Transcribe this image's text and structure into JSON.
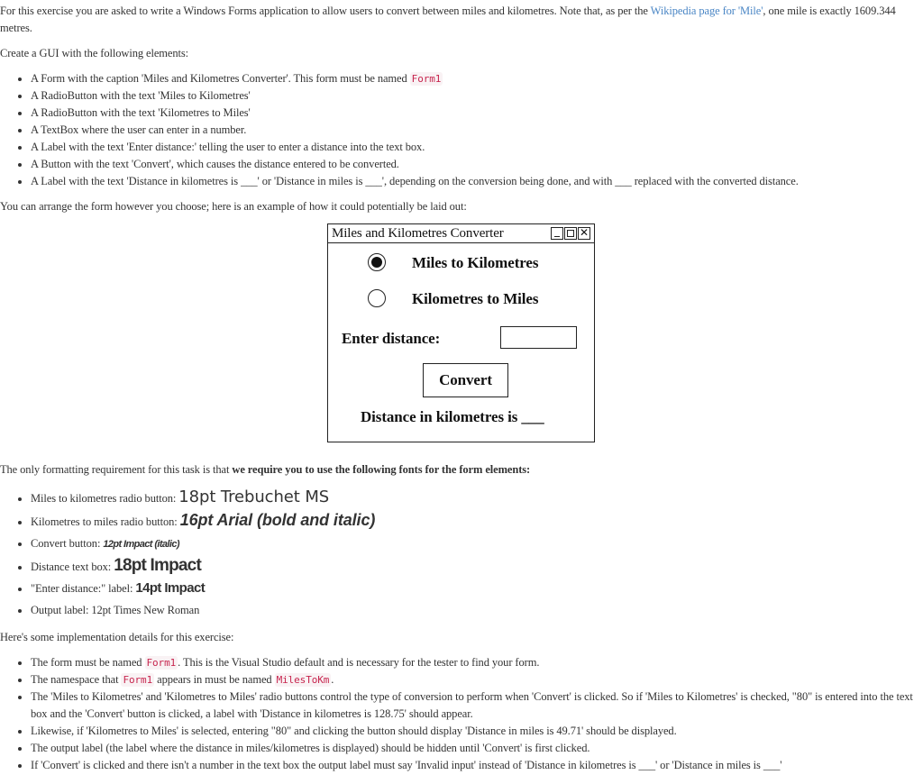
{
  "intro": {
    "text_before_link": "For this exercise you are asked to write a Windows Forms application to allow users to convert between miles and kilometres. Note that, as per the ",
    "link_text": "Wikipedia page for 'Mile'",
    "text_after_link": ", one mile is exactly 1609.344 metres."
  },
  "gui_heading": "Create a GUI with the following elements:",
  "gui_elements": [
    {
      "text": "A Form with the caption 'Miles and Kilometres Converter'. This form must be named ",
      "code": "Form1"
    },
    {
      "text": "A RadioButton with the text 'Miles to Kilometres'"
    },
    {
      "text": "A RadioButton with the text 'Kilometres to Miles'"
    },
    {
      "text": "A TextBox where the user can enter in a number."
    },
    {
      "text": "A Label with the text 'Enter distance:' telling the user to enter a distance into the text box."
    },
    {
      "text": "A Button with the text 'Convert', which causes the distance entered to be converted."
    },
    {
      "text": "A Label with the text 'Distance in kilometres is ___' or 'Distance in miles is ___', depending on the conversion being done, and with ___ replaced with the converted distance."
    }
  ],
  "layout_note": "You can arrange the form however you choose; here is an example of how it could potentially be laid out:",
  "mockup": {
    "title": "Miles and Kilometres Converter",
    "window_buttons": [
      "minimize-icon",
      "maximize-icon",
      "close-icon"
    ],
    "close_glyph": "✕",
    "radio_miles_to_km": "Miles to Kilometres",
    "radio_km_to_miles": "Kilometres to Miles",
    "selected_radio": "Miles to Kilometres",
    "enter_label": "Enter distance:",
    "textbox_value": "",
    "convert_button": "Convert",
    "output_label": "Distance in kilometres is ___"
  },
  "formatting": {
    "text_before_bold": "The only formatting requirement for this task is that ",
    "bold_text": "we require you to use the following fonts for the form elements:"
  },
  "font_requirements": [
    {
      "label": "Miles to kilometres radio button: ",
      "sample": "18pt Trebuchet MS"
    },
    {
      "label": "Kilometres to miles radio button: ",
      "sample": "16pt Arial (bold and italic)"
    },
    {
      "label": "Convert button: ",
      "sample": "12pt Impact (italic)"
    },
    {
      "label": "Distance text box: ",
      "sample": "18pt Impact"
    },
    {
      "label": "\"Enter distance:\" label: ",
      "sample": "14pt Impact"
    },
    {
      "label": "Output label: ",
      "sample": "12pt Times New Roman"
    }
  ],
  "impl_heading": "Here's some implementation details for this exercise:",
  "impl_details": {
    "d0_a": "The form must be named ",
    "d0_code": "Form1",
    "d0_b": ". This is the Visual Studio default and is necessary for the tester to find your form.",
    "d1_a": "The namespace that ",
    "d1_code1": "Form1",
    "d1_b": " appears in must be named ",
    "d1_code2": "MilesToKm",
    "d1_c": ".",
    "d2": "The 'Miles to Kilometres' and 'Kilometres to Miles' radio buttons control the type of conversion to perform when 'Convert' is clicked. So if 'Miles to Kilometres' is checked, \"80\" is entered into the text box and the 'Convert' button is clicked, a label with 'Distance in kilometres is 128.75' should appear.",
    "d3": "Likewise, if 'Kilometres to Miles' is selected, entering \"80\" and clicking the button should display 'Distance in miles is 49.71' should be displayed.",
    "d4": "The output label (the label where the distance in miles/kilometres is displayed) should be hidden until 'Convert' is first clicked.",
    "d5": "If 'Convert' is clicked and there isn't a number in the text box the output label must say 'Invalid input' instead of 'Distance in kilometres is ___' or 'Distance in miles is ___'"
  }
}
